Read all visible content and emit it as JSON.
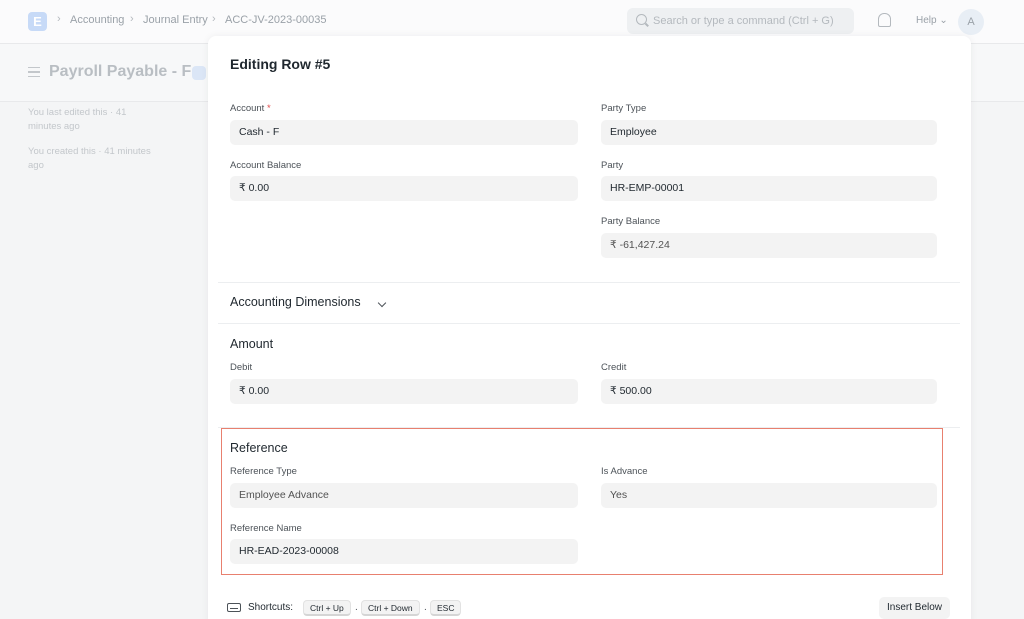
{
  "navbar": {
    "logo": "E",
    "breadcrumbs": [
      "Accounting",
      "Journal Entry",
      "ACC-JV-2023-00035"
    ],
    "search_placeholder": "Search or type a command (Ctrl + G)",
    "help_label": "Help",
    "avatar_initial": "A"
  },
  "page": {
    "title": "Payroll Payable - F",
    "last_edited": "You last edited this · 41 minutes ago",
    "created": "You created this · 41 minutes ago",
    "ghost_button": "el"
  },
  "modal": {
    "title": "Editing Row #5",
    "account": {
      "label": "Account",
      "required_mark": "*",
      "value": "Cash - F"
    },
    "account_balance": {
      "label": "Account Balance",
      "value": "₹ 0.00"
    },
    "party_type": {
      "label": "Party Type",
      "value": "Employee"
    },
    "party": {
      "label": "Party",
      "value": "HR-EMP-00001"
    },
    "party_balance": {
      "label": "Party Balance",
      "value": "₹ -61,427.24"
    },
    "accounting_dimensions": {
      "title": "Accounting Dimensions"
    },
    "amount": {
      "title": "Amount",
      "debit": {
        "label": "Debit",
        "value": "₹ 0.00"
      },
      "credit": {
        "label": "Credit",
        "value": "₹ 500.00"
      }
    },
    "reference": {
      "title": "Reference",
      "reference_type": {
        "label": "Reference Type",
        "value": "Employee Advance"
      },
      "is_advance": {
        "label": "Is Advance",
        "value": "Yes"
      },
      "reference_name": {
        "label": "Reference Name",
        "value": "HR-EAD-2023-00008"
      }
    },
    "footer": {
      "shortcuts_label": "Shortcuts:",
      "keys": [
        "Ctrl + Up",
        "Ctrl + Down",
        "ESC"
      ],
      "separator": ".",
      "insert_below": "Insert Below"
    }
  },
  "colors": {
    "highlight_border": "#e8806f",
    "required": "#e24c4c"
  }
}
